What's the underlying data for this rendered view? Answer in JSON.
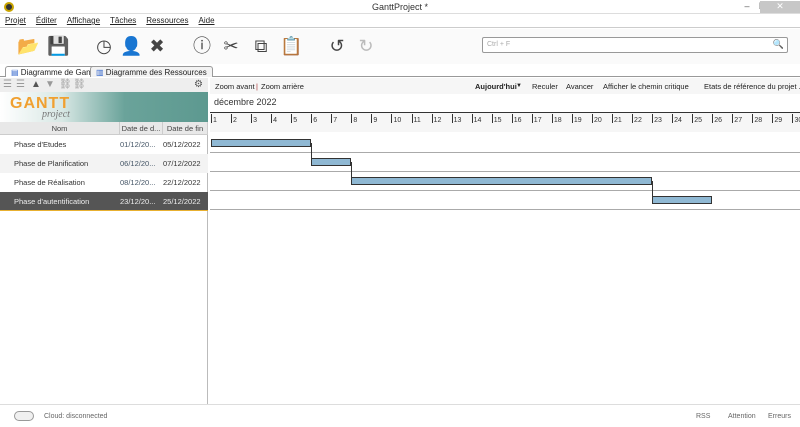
{
  "window": {
    "title": "GanttProject *",
    "minimize": "–",
    "maximize": "❐",
    "close": "✕"
  },
  "menu": [
    "Projet",
    "Éditer",
    "Affichage",
    "Tâches",
    "Ressources",
    "Aide"
  ],
  "toolbar": {
    "search_placeholder": "Ctrl + F"
  },
  "tabs": [
    {
      "label": "Diagramme de Gantt"
    },
    {
      "label": "Diagramme des Ressources"
    }
  ],
  "tasks": {
    "columns": [
      "Nom",
      "Date de d...",
      "Date de fin"
    ],
    "rows": [
      {
        "name": "Phase d'Etudes",
        "start": "01/12/20...",
        "end": "05/12/2022",
        "bar_start_day": 1,
        "bar_end_day": 6
      },
      {
        "name": "Phase de Planification",
        "start": "06/12/20...",
        "end": "07/12/2022",
        "bar_start_day": 6,
        "bar_end_day": 8
      },
      {
        "name": "Phase de Réalisation",
        "start": "08/12/20...",
        "end": "22/12/2022",
        "bar_start_day": 8,
        "bar_end_day": 23
      },
      {
        "name": "Phase d'autentification",
        "start": "23/12/20...",
        "end": "25/12/2022",
        "bar_start_day": 23,
        "bar_end_day": 26
      }
    ],
    "selected_index": 3
  },
  "logo": {
    "line1": "GANTT",
    "line2": "project"
  },
  "gantt": {
    "zoom_in": "Zoom avant",
    "zoom_out": "Zoom arrière",
    "today": "Aujourd'hui",
    "back": "Reculer",
    "forward": "Avancer",
    "critical_path": "Afficher le chemin critique",
    "baselines": "Etats de référence du projet ...",
    "month": "décembre 2022",
    "days": 30,
    "bar_color": "#8fb8d3"
  },
  "status": {
    "cloud": "Cloud: disconnected",
    "rss": "RSS",
    "warning": "Attention",
    "errors": "Erreurs"
  }
}
